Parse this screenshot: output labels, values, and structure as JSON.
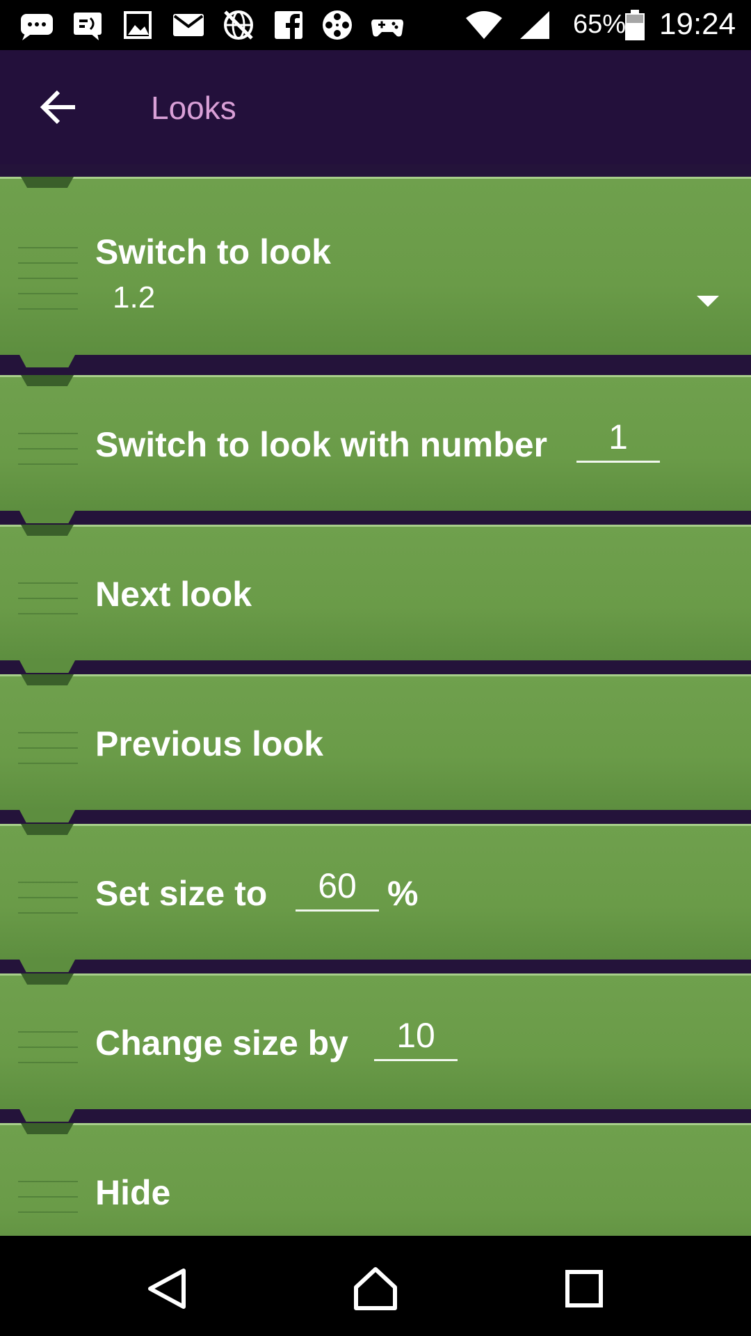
{
  "status_bar": {
    "icons": [
      "chat-bubble-icon",
      "message-icon",
      "image-icon",
      "mail-icon",
      "globe-off-icon",
      "facebook-icon",
      "film-reel-icon",
      "game-controller-icon",
      "wifi-icon",
      "cell-signal-icon",
      "battery-icon"
    ],
    "battery": "65%",
    "time": "19:24"
  },
  "app_bar": {
    "title": "Looks",
    "back_icon": "arrow-left-icon"
  },
  "bricks": [
    {
      "label": "Switch to look",
      "dropdown_value": "1.2"
    },
    {
      "label": "Switch to look with number",
      "field_value": "1"
    },
    {
      "label": "Next look"
    },
    {
      "label": "Previous look"
    },
    {
      "label": "Set size to",
      "field_value": "60",
      "suffix": "%"
    },
    {
      "label": "Change size by",
      "field_value": "10"
    },
    {
      "label": "Hide"
    }
  ],
  "nav_bar": {
    "back": "triangle-back-icon",
    "home": "home-icon",
    "recents": "square-recents-icon"
  },
  "colors": {
    "brick_green": "#6a9b48",
    "app_bar": "#23103b",
    "title_pink": "#d9a0d7"
  }
}
